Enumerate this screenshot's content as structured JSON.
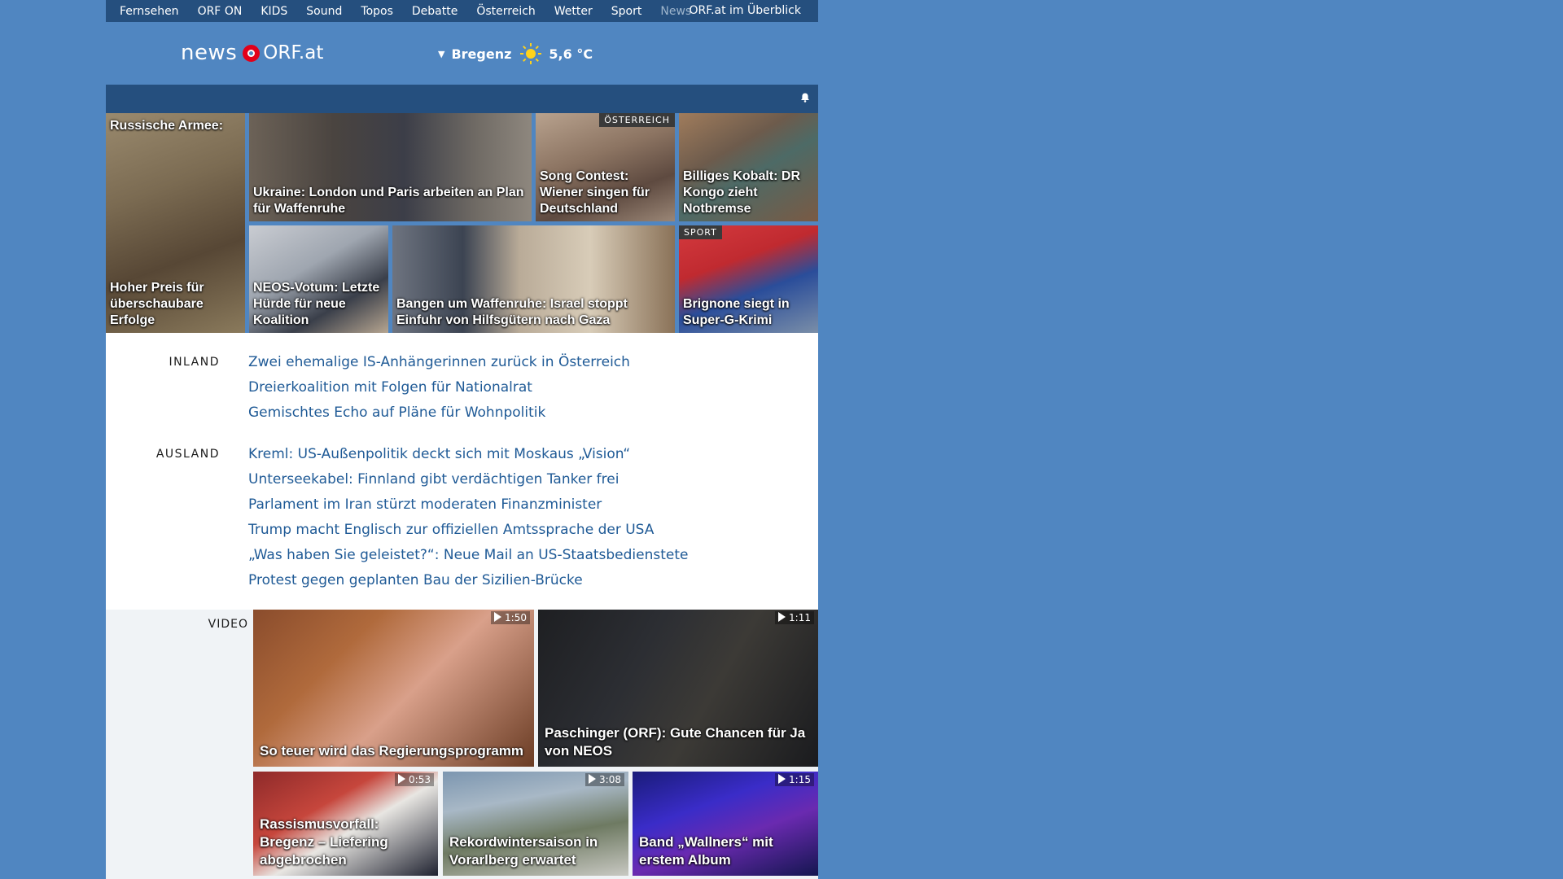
{
  "topnav": {
    "items": [
      "Fernsehen",
      "ORF ON",
      "KIDS",
      "Sound",
      "Topos",
      "Debatte",
      "Österreich",
      "Wetter",
      "Sport",
      "News"
    ],
    "overview": "ORF.at im Überblick"
  },
  "brand": {
    "news": "news",
    "orf": "ORF.at"
  },
  "weather": {
    "city": "Bregenz",
    "temperature": "5,6 °C",
    "icon": "sun-icon"
  },
  "hero": {
    "tiles": [
      {
        "caption_top": "Russische Armee:",
        "caption": "Hoher Preis für überschaubare Erfolge"
      },
      {
        "caption": "Ukraine: London und Paris arbeiten an Plan für Waffenruhe"
      },
      {
        "tag": "ÖSTERREICH",
        "caption": "Song Contest: Wiener singen für Deutschland"
      },
      {
        "caption": "Billiges Kobalt: DR Kongo zieht Notbremse"
      },
      {
        "caption": "NEOS-Votum: Letzte Hürde für neue Koalition"
      },
      {
        "caption": "Bangen um Waffenruhe: Israel stoppt Einfuhr von Hilfsgütern nach Gaza"
      },
      {
        "tag": "SPORT",
        "caption": "Brignone siegt in Super-G-Krimi"
      }
    ]
  },
  "inland": {
    "label": "INLAND",
    "links": [
      "Zwei ehemalige IS-Anhängerinnen zurück in Österreich",
      "Dreierkoalition mit Folgen für Nationalrat",
      "Gemischtes Echo auf Pläne für Wohnpolitik"
    ]
  },
  "ausland": {
    "label": "AUSLAND",
    "links": [
      "Kreml: US-Außenpolitik deckt sich mit Moskaus „Vision“",
      "Unterseekabel: Finnland gibt verdächtigen Tanker frei",
      "Parlament im Iran stürzt moderaten Finanzminister",
      "Trump macht Englisch zur offiziellen Amtssprache der USA",
      "„Was haben Sie geleistet?“: Neue Mail an US-Staatsbedienstete",
      "Protest gegen geplanten Bau der Sizilien-Brücke"
    ]
  },
  "video": {
    "label": "VIDEO",
    "items": [
      {
        "duration": "1:50",
        "caption": "So teuer wird das Regierungsprogramm"
      },
      {
        "duration": "1:11",
        "caption": "Paschinger (ORF): Gute Chancen für Ja von NEOS"
      },
      {
        "duration": "0:53",
        "caption": "Rassismusvorfall: Bregenz – Liefering abgebrochen"
      },
      {
        "duration": "3:08",
        "caption": "Rekordwintersaison in Vorarlberg erwartet"
      },
      {
        "duration": "1:15",
        "caption": "Band „Wallners“ mit erstem Album"
      }
    ]
  },
  "colors": {
    "page_bg": "#5086c1",
    "nav_bg": "#254f7e",
    "link": "#1f5a96",
    "orf_red": "#e2001a"
  }
}
